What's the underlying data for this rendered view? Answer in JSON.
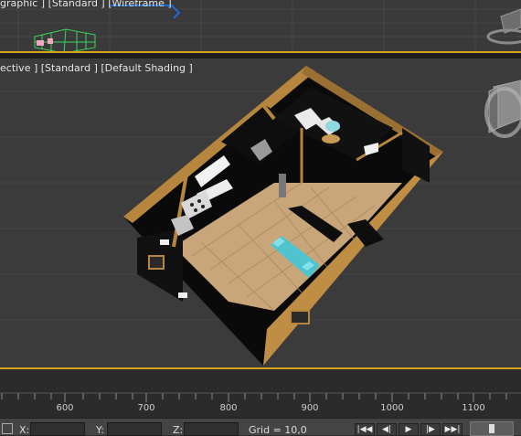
{
  "viewports": {
    "top": {
      "label": "graphic ] [Standard ] [Wireframe ]"
    },
    "main": {
      "label": "ective ] [Standard ] [Default Shading ]"
    }
  },
  "timeline": {
    "ticks": [
      {
        "label": "600"
      },
      {
        "label": "700"
      },
      {
        "label": "800"
      },
      {
        "label": "900"
      },
      {
        "label": "1000"
      },
      {
        "label": "1100"
      }
    ]
  },
  "status_bar": {
    "x_label": "X:",
    "y_label": "Y:",
    "z_label": "Z:",
    "x_value": "",
    "y_value": "",
    "z_value": "",
    "grid_text": "Grid = 10,0"
  },
  "playback": {
    "buttons": [
      {
        "name": "go-to-start-icon",
        "glyph": "|◀◀"
      },
      {
        "name": "previous-frame-icon",
        "glyph": "◀|"
      },
      {
        "name": "play-icon",
        "glyph": "▶"
      },
      {
        "name": "next-frame-icon",
        "glyph": "|▶"
      },
      {
        "name": "go-to-end-icon",
        "glyph": "▶▶|"
      }
    ]
  },
  "colors": {
    "active_border": "#d7a318",
    "viewport_bg": "#3b3b3b",
    "wall_wood": "#b6863f",
    "floor_tile": "#c8a67a",
    "wall_black": "#0a0a0a",
    "sofa": "#4fc4cf"
  }
}
